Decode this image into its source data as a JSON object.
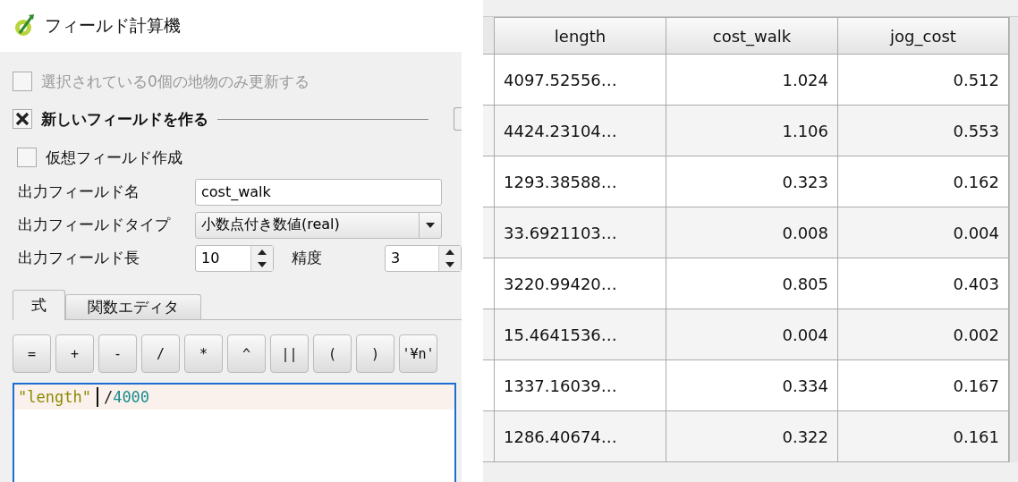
{
  "dialog": {
    "title": "フィールド計算機",
    "update_selected": {
      "label": "選択されている0個の地物のみ更新する",
      "checked": false,
      "disabled": true
    },
    "create_field": {
      "label": "新しいフィールドを作る",
      "checked": true
    },
    "virtual_field": {
      "label": "仮想フィールド作成",
      "checked": false
    },
    "output_name": {
      "label": "出力フィールド名",
      "value": "cost_walk"
    },
    "output_type": {
      "label": "出力フィールドタイプ",
      "value": "小数点付き数値(real)"
    },
    "output_length": {
      "label": "出力フィールド長",
      "value": "10"
    },
    "precision": {
      "label": "精度",
      "value": "3"
    },
    "tabs": [
      {
        "label": "式",
        "selected": true
      },
      {
        "label": "関数エディタ",
        "selected": false
      }
    ],
    "operators": [
      "=",
      "+",
      "-",
      "/",
      "*",
      "^",
      "||",
      "(",
      ")",
      "'¥n'"
    ],
    "expression": [
      {
        "kind": "field",
        "text": "\"length\""
      },
      {
        "kind": "operator",
        "text": "/"
      },
      {
        "kind": "number",
        "text": "4000"
      }
    ]
  },
  "table": {
    "columns": [
      "length",
      "cost_walk",
      "jog_cost"
    ],
    "rows": [
      [
        "4097.52556…",
        "1.024",
        "0.512"
      ],
      [
        "4424.23104…",
        "1.106",
        "0.553"
      ],
      [
        "1293.38588…",
        "0.323",
        "0.162"
      ],
      [
        "33.6921103…",
        "0.008",
        "0.004"
      ],
      [
        "3220.99420…",
        "0.805",
        "0.403"
      ],
      [
        "15.4641536…",
        "0.004",
        "0.002"
      ],
      [
        "1337.16039…",
        "0.334",
        "0.167"
      ],
      [
        "1286.40674…",
        "0.322",
        "0.161"
      ]
    ]
  }
}
